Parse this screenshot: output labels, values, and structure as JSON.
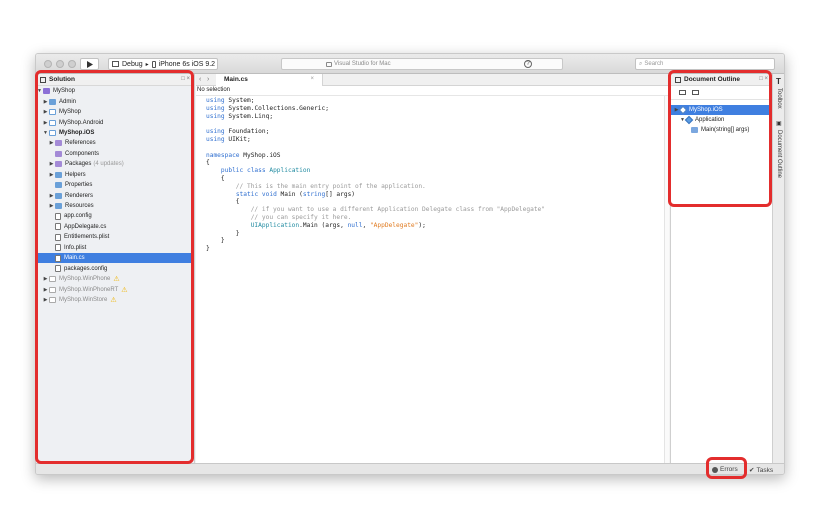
{
  "window": {
    "run_config": "Debug",
    "device": "iPhone 6s iOS 9.2",
    "status_text": "Visual Studio for Mac",
    "help_glyph": "?",
    "search_placeholder": "Search"
  },
  "solution": {
    "title": "Solution",
    "controls": "□ ×",
    "items": [
      {
        "label": "MyShop",
        "extra": ""
      },
      {
        "label": "Admin",
        "extra": ""
      },
      {
        "label": "MyShop",
        "extra": ""
      },
      {
        "label": "MyShop.Android",
        "extra": ""
      },
      {
        "label": "MyShop.iOS",
        "extra": ""
      },
      {
        "label": "References",
        "extra": ""
      },
      {
        "label": "Components",
        "extra": ""
      },
      {
        "label": "Packages",
        "extra": "(4 updates)"
      },
      {
        "label": "Helpers",
        "extra": ""
      },
      {
        "label": "Properties",
        "extra": ""
      },
      {
        "label": "Renderers",
        "extra": ""
      },
      {
        "label": "Resources",
        "extra": ""
      },
      {
        "label": "app.config",
        "extra": ""
      },
      {
        "label": "AppDelegate.cs",
        "extra": ""
      },
      {
        "label": "Entitlements.plist",
        "extra": ""
      },
      {
        "label": "Info.plist",
        "extra": ""
      },
      {
        "label": "Main.cs",
        "extra": ""
      },
      {
        "label": "packages.config",
        "extra": ""
      },
      {
        "label": "MyShop.WinPhone",
        "extra": ""
      },
      {
        "label": "MyShop.WinPhoneRT",
        "extra": ""
      },
      {
        "label": "MyShop.WinStore",
        "extra": ""
      }
    ]
  },
  "editor": {
    "tab_label": "Main.cs",
    "tab_close": "×",
    "selection_text": "No selection",
    "code": [
      {
        "t": [
          {
            "c": "kw",
            "s": "using"
          },
          {
            "c": "p",
            "s": " System;"
          }
        ]
      },
      {
        "t": [
          {
            "c": "kw",
            "s": "using"
          },
          {
            "c": "p",
            "s": " System.Collections.Generic;"
          }
        ]
      },
      {
        "t": [
          {
            "c": "kw",
            "s": "using"
          },
          {
            "c": "p",
            "s": " System.Linq;"
          }
        ]
      },
      {
        "t": []
      },
      {
        "t": [
          {
            "c": "kw",
            "s": "using"
          },
          {
            "c": "p",
            "s": " Foundation;"
          }
        ]
      },
      {
        "t": [
          {
            "c": "kw",
            "s": "using"
          },
          {
            "c": "p",
            "s": " UIKit;"
          }
        ]
      },
      {
        "t": []
      },
      {
        "t": [
          {
            "c": "kw",
            "s": "namespace"
          },
          {
            "c": "p",
            "s": " MyShop.iOS"
          }
        ]
      },
      {
        "t": [
          {
            "c": "p",
            "s": "{"
          }
        ]
      },
      {
        "t": [
          {
            "c": "p",
            "s": "    "
          },
          {
            "c": "kw",
            "s": "public class"
          },
          {
            "c": "p",
            "s": " "
          },
          {
            "c": "ty",
            "s": "Application"
          }
        ]
      },
      {
        "t": [
          {
            "c": "p",
            "s": "    {"
          }
        ]
      },
      {
        "t": [
          {
            "c": "cm",
            "s": "        // This is the main entry point of the application."
          }
        ]
      },
      {
        "t": [
          {
            "c": "p",
            "s": "        "
          },
          {
            "c": "kw",
            "s": "static void"
          },
          {
            "c": "p",
            "s": " Main ("
          },
          {
            "c": "kw",
            "s": "string"
          },
          {
            "c": "p",
            "s": "[] args)"
          }
        ]
      },
      {
        "t": [
          {
            "c": "p",
            "s": "        {"
          }
        ]
      },
      {
        "t": [
          {
            "c": "cm",
            "s": "            // if you want to use a different Application Delegate class from \"AppDelegate\""
          }
        ]
      },
      {
        "t": [
          {
            "c": "cm",
            "s": "            // you can specify it here."
          }
        ]
      },
      {
        "t": [
          {
            "c": "p",
            "s": "            "
          },
          {
            "c": "ty",
            "s": "UIApplication"
          },
          {
            "c": "p",
            "s": ".Main (args, "
          },
          {
            "c": "kw",
            "s": "null"
          },
          {
            "c": "p",
            "s": ", "
          },
          {
            "c": "st",
            "s": "\"AppDelegate\""
          },
          {
            "c": "p",
            "s": ");"
          }
        ]
      },
      {
        "t": [
          {
            "c": "p",
            "s": "        }"
          }
        ]
      },
      {
        "t": [
          {
            "c": "p",
            "s": "    }"
          }
        ]
      },
      {
        "t": [
          {
            "c": "p",
            "s": "}"
          }
        ]
      }
    ]
  },
  "outline": {
    "title": "Document Outline",
    "controls": "□ ×",
    "items": [
      {
        "label": "MyShop.iOS"
      },
      {
        "label": "Application"
      },
      {
        "label": "Main(string[] args)"
      }
    ]
  },
  "dock": {
    "toolbox": "Toolbox",
    "doc_outline": "Document Outline"
  },
  "statusbar": {
    "errors": "Errors",
    "tasks": "Tasks"
  },
  "colors": {
    "highlight": "#e32d2d",
    "selection": "#3f7fe0",
    "keyword": "#2f6fd0",
    "comment": "#9a9a9a",
    "string": "#e07a1f",
    "type": "#1f8aa0",
    "warning": "#f0b400"
  }
}
